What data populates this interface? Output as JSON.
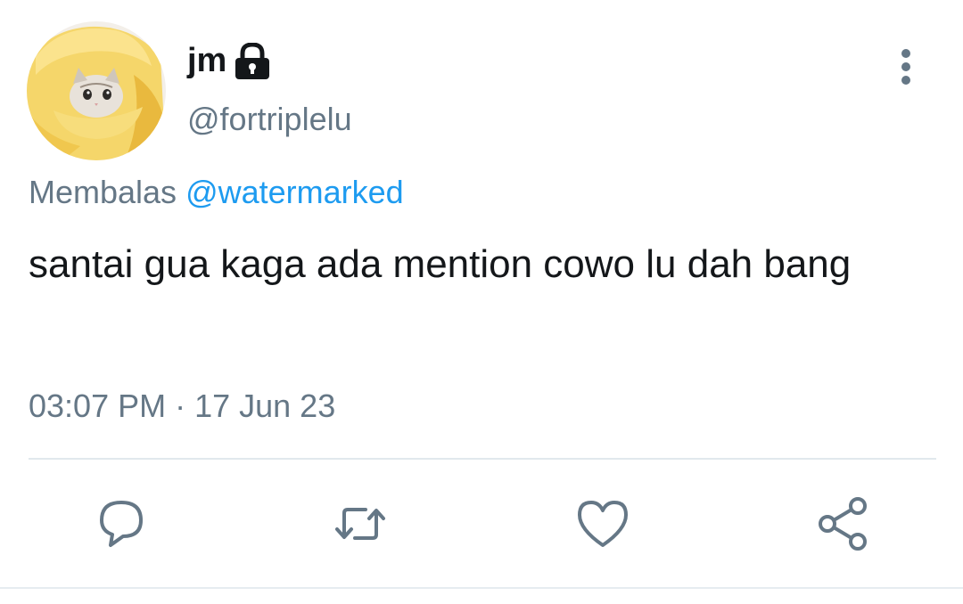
{
  "tweet": {
    "author": {
      "display_name": "jm",
      "handle": "@fortriplelu",
      "avatar": "cat-in-banana-hat-avatar",
      "protected_icon": "lock-icon"
    },
    "more_icon": "vertical-ellipsis-icon",
    "reply_prefix": "Membalas",
    "reply_mention": "@watermarked",
    "text": "santai gua kaga ada mention cowo lu dah bang",
    "timestamp": "03:07 PM · 17 Jun 23",
    "actions": [
      {
        "name": "reply",
        "icon": "comment-icon"
      },
      {
        "name": "retweet",
        "icon": "retweet-icon"
      },
      {
        "name": "like",
        "icon": "heart-icon"
      },
      {
        "name": "share",
        "icon": "share-icon"
      }
    ],
    "colors": {
      "text": "#14171a",
      "secondary": "#657786",
      "link": "#1d9bf0",
      "divider": "#e1e8ed"
    }
  }
}
